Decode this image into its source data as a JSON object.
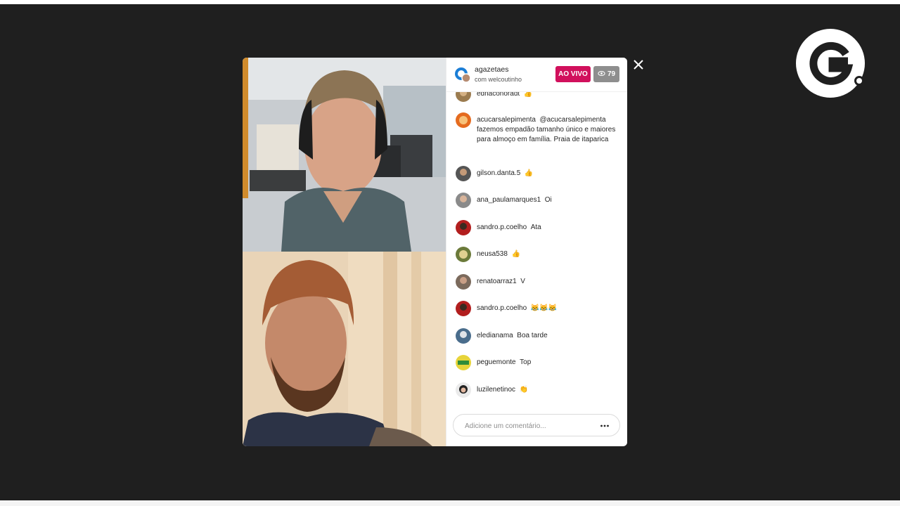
{
  "modal": {
    "host": {
      "username": "agazetaes",
      "with_label": "com welcoutinho"
    },
    "live_label": "AO VIVO",
    "viewer_count": "79",
    "comments": [
      {
        "user": "ednaconoradt",
        "message": "👍"
      },
      {
        "user": "acucarsalepimenta",
        "message": "@acucarsalepimenta fazemos empadão tamanho único e maiores para almoço em família. Praia de itaparica"
      },
      {
        "user": "gilson.danta.5",
        "message": "👍"
      },
      {
        "user": "ana_paulamarques1",
        "message": "Oi"
      },
      {
        "user": "sandro.p.coelho",
        "message": "Ata"
      },
      {
        "user": "neusa538",
        "message": "👍"
      },
      {
        "user": "renatoarraz1",
        "message": "V"
      },
      {
        "user": "sandro.p.coelho",
        "message": "😹😹😹"
      },
      {
        "user": "eledianama",
        "message": "Boa tarde"
      },
      {
        "user": "peguemonte",
        "message": "Top"
      },
      {
        "user": "luzilenetinoc",
        "message": "👏"
      }
    ],
    "comment_placeholder": "Adicione um comentário..."
  },
  "icons": {
    "close": "close-icon",
    "more": "more-horizontal-icon",
    "viewers": "eye-icon",
    "brand": "g-logo"
  },
  "colors": {
    "live_badge": "#d1105c",
    "viewer_badge": "#8e8e8e",
    "background": "#1f1f1f"
  }
}
